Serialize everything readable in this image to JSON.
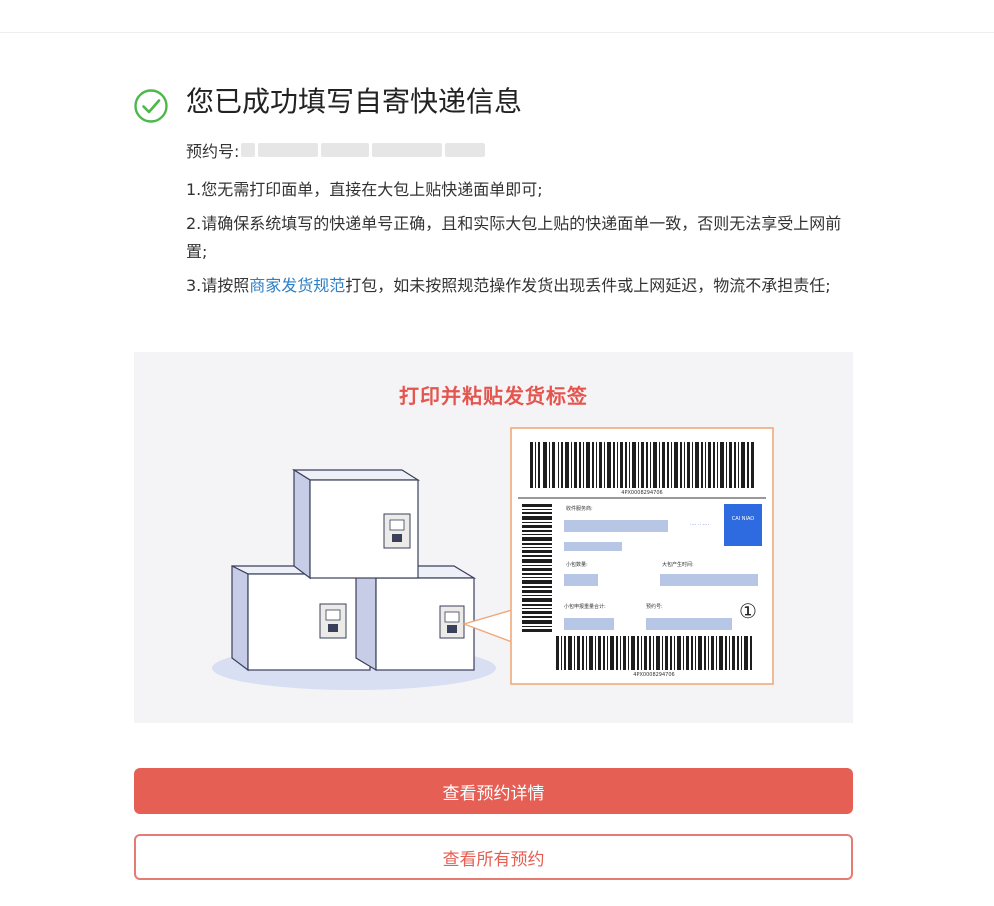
{
  "header": {
    "title": "您已成功填写自寄快递信息",
    "icon": "check-circle-icon",
    "accent": "#4cb84a"
  },
  "booking": {
    "label": "预约号:",
    "value_redacted": true
  },
  "notes": {
    "line1": "1.您无需打印面单，直接在大包上贴快递面单即可;",
    "line2": "2.请确保系统填写的快递单号正确，且和实际大包上贴的快递面单一致，否则无法享受上网前置;",
    "line3_before": "3.请按照",
    "line3_link": "商家发货规范",
    "line3_after": "打包，如未按照规范操作发货出现丢件或上网延迟，物流不承担责任;"
  },
  "illustration": {
    "title": "打印并粘贴发货标签",
    "label": {
      "tracking_number": "4PX0008294706",
      "field_recipient": "收件服务商:",
      "field_small_count": "小包数量:",
      "field_bag_time": "大包产生时间:",
      "field_weight_total": "小包申报重量合计:",
      "field_booking_no": "预约号:",
      "circled_number": "①",
      "logo_text": "CAI NIAO"
    }
  },
  "buttons": {
    "primary": "查看预约详情",
    "secondary": "查看所有预约"
  },
  "colors": {
    "primary_button": "#e55f55",
    "link": "#2e7fc5",
    "illustration_title": "#e4554e",
    "label_border": "#f0a87a"
  }
}
